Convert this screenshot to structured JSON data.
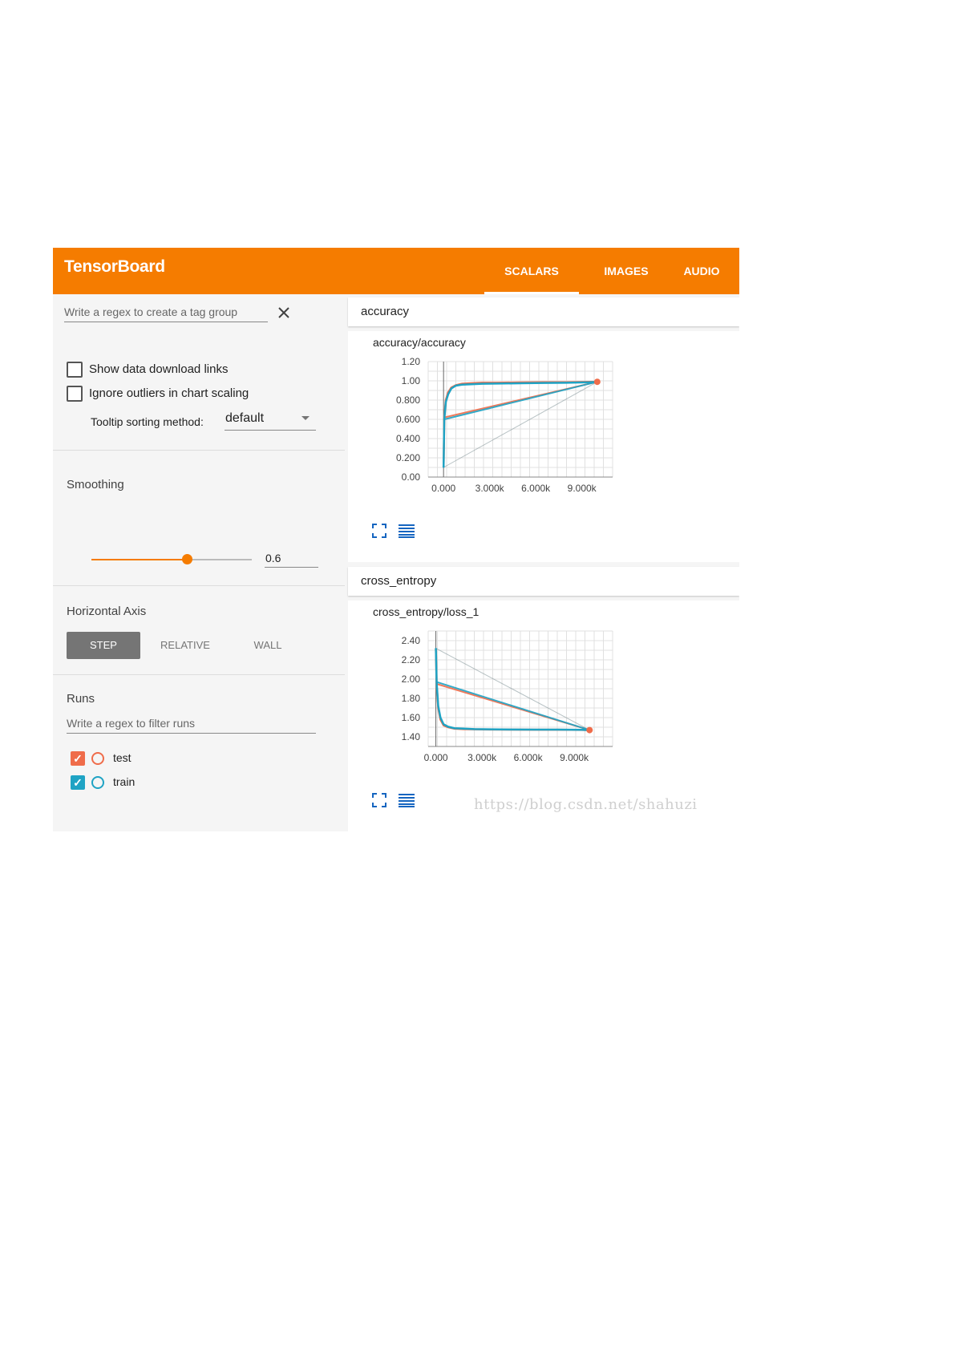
{
  "header": {
    "brand": "TensorBoard",
    "tabs": [
      {
        "label": "SCALARS",
        "active": true
      },
      {
        "label": "IMAGES",
        "active": false
      },
      {
        "label": "AUDIO",
        "active": false
      }
    ],
    "color": "#f57c00"
  },
  "sidebar": {
    "tag_group_placeholder": "Write a regex to create a tag group",
    "close_icon": "close-icon",
    "options": [
      {
        "label": "Show data download links",
        "checked": false
      },
      {
        "label": "Ignore outliers in chart scaling",
        "checked": false
      }
    ],
    "tooltip_sorting": {
      "label": "Tooltip sorting method:",
      "value": "default"
    },
    "smoothing": {
      "title": "Smoothing",
      "value": "0.6",
      "fraction": 0.6
    },
    "horizontal_axis": {
      "title": "Horizontal Axis",
      "options": [
        "STEP",
        "RELATIVE",
        "WALL"
      ],
      "selected": "STEP"
    },
    "runs": {
      "title": "Runs",
      "filter_placeholder": "Write a regex to filter runs",
      "items": [
        {
          "label": "test",
          "checked": true,
          "color": "#ef6c4a"
        },
        {
          "label": "train",
          "checked": true,
          "color": "#1fa3c4"
        }
      ]
    }
  },
  "cards": [
    {
      "header": "accuracy",
      "chart_title": "accuracy/accuracy"
    },
    {
      "header": "cross_entropy",
      "chart_title": "cross_entropy/loss_1"
    }
  ],
  "watermark": "https://blog.csdn.net/shahuzi",
  "chart_data": [
    {
      "type": "line",
      "title": "accuracy/accuracy",
      "xlabel": "",
      "ylabel": "",
      "x_ticks": [
        "0.000",
        "3.000k",
        "6.000k",
        "9.000k"
      ],
      "y_ticks": [
        "0.00",
        "0.200",
        "0.400",
        "0.600",
        "0.800",
        "1.00",
        "1.20"
      ],
      "xlim": [
        -1000,
        11000
      ],
      "ylim": [
        0,
        1.2
      ],
      "grid": true,
      "series": [
        {
          "name": "test",
          "color": "#ef6c4a",
          "x": [
            0,
            50,
            150,
            300,
            500,
            800,
            1200,
            1800,
            2500,
            3500,
            5000,
            6500,
            8000,
            9500,
            10000
          ],
          "y": [
            0.1,
            0.62,
            0.8,
            0.88,
            0.93,
            0.955,
            0.97,
            0.975,
            0.98,
            0.98,
            0.983,
            0.985,
            0.985,
            0.99,
            0.99
          ]
        },
        {
          "name": "train",
          "color": "#1fa3c4",
          "x": [
            0,
            50,
            150,
            300,
            500,
            800,
            1200,
            1800,
            2500,
            3500,
            5000,
            6500,
            8000,
            9500,
            10000
          ],
          "y": [
            0.1,
            0.6,
            0.78,
            0.86,
            0.92,
            0.95,
            0.96,
            0.965,
            0.97,
            0.972,
            0.975,
            0.978,
            0.98,
            0.985,
            0.99
          ]
        }
      ]
    },
    {
      "type": "line",
      "title": "cross_entropy/loss_1",
      "xlabel": "",
      "ylabel": "",
      "x_ticks": [
        "0.000",
        "3.000k",
        "6.000k",
        "9.000k"
      ],
      "y_ticks": [
        "1.40",
        "1.60",
        "1.80",
        "2.00",
        "2.20",
        "2.40"
      ],
      "xlim": [
        -500,
        11500
      ],
      "ylim": [
        1.3,
        2.5
      ],
      "grid": true,
      "series": [
        {
          "name": "test",
          "color": "#ef6c4a",
          "x": [
            0,
            50,
            150,
            300,
            500,
            800,
            1200,
            1800,
            2500,
            3500,
            5000,
            6500,
            8000,
            9500,
            10000
          ],
          "y": [
            2.32,
            1.95,
            1.7,
            1.58,
            1.52,
            1.5,
            1.485,
            1.48,
            1.478,
            1.476,
            1.475,
            1.474,
            1.474,
            1.472,
            1.47
          ]
        },
        {
          "name": "train",
          "color": "#1fa3c4",
          "x": [
            0,
            50,
            150,
            300,
            500,
            800,
            1200,
            1800,
            2500,
            3500,
            5000,
            6500,
            8000,
            9500,
            10000
          ],
          "y": [
            2.32,
            1.97,
            1.72,
            1.6,
            1.53,
            1.505,
            1.49,
            1.485,
            1.48,
            1.478,
            1.476,
            1.475,
            1.475,
            1.473,
            1.47
          ]
        }
      ]
    }
  ]
}
